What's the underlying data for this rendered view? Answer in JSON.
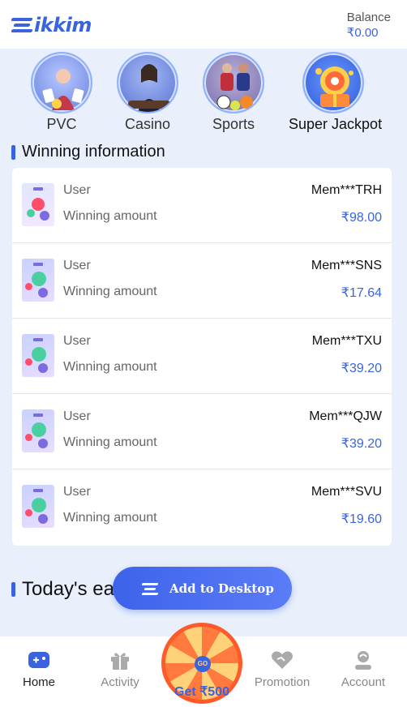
{
  "header": {
    "logo_text": "ikkim",
    "balance_label": "Balance",
    "balance_value": "₹0.00"
  },
  "categories": [
    {
      "label": "PVC"
    },
    {
      "label": "Casino"
    },
    {
      "label": "Sports"
    },
    {
      "label": "Super Jackpot"
    }
  ],
  "winning": {
    "title": "Winning information",
    "user_label": "User",
    "amount_label": "Winning amount",
    "rows": [
      {
        "user": "Mem***TRH",
        "amount": "₹98.00"
      },
      {
        "user": "Mem***SNS",
        "amount": "₹17.64"
      },
      {
        "user": "Mem***TXU",
        "amount": "₹39.20"
      },
      {
        "user": "Mem***QJW",
        "amount": "₹39.20"
      },
      {
        "user": "Mem***SVU",
        "amount": "₹19.60"
      }
    ]
  },
  "earnings": {
    "title_visible": "Today's ea"
  },
  "add_desktop": {
    "label": "Add to Desktop"
  },
  "nav": {
    "items": [
      {
        "label": "Home"
      },
      {
        "label": "Activity"
      },
      {
        "label": "Promotion"
      },
      {
        "label": "Account"
      }
    ],
    "wheel_hub": "GO",
    "promo_label": "Get ₹500"
  },
  "colors": {
    "accent": "#3a63e0",
    "background": "#e9effb"
  }
}
